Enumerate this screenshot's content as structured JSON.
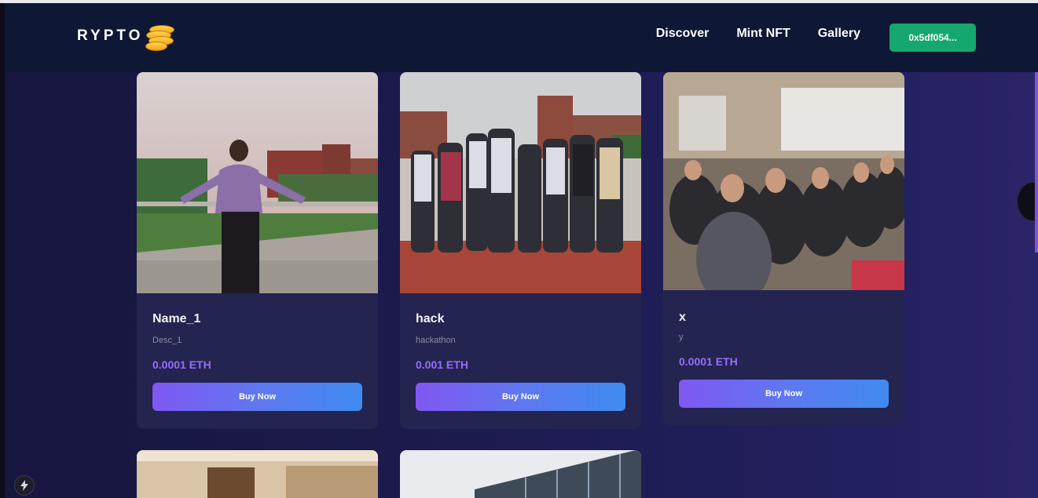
{
  "brand": {
    "name": "RYPTO"
  },
  "nav": {
    "links": [
      "Discover",
      "Mint NFT",
      "Gallery"
    ],
    "wallet_address": "0x5df054..."
  },
  "nfts": [
    {
      "name": "Name_1",
      "description": "Desc_1",
      "price": "0.0001 ETH",
      "button": "Buy Now"
    },
    {
      "name": "hack",
      "description": "hackathon",
      "price": "0.001 ETH",
      "button": "Buy Now"
    },
    {
      "name": "x",
      "description": "y",
      "price": "0.0001 ETH",
      "button": "Buy Now"
    }
  ],
  "icons": {
    "logo_icon": "gold-coins-icon",
    "bottom_left": "lightning-icon"
  },
  "colors": {
    "accent_green": "#14a86e",
    "price_purple": "#9b6cff",
    "button_gradient_start": "#8058f2",
    "button_gradient_end": "#3f8bf0"
  }
}
